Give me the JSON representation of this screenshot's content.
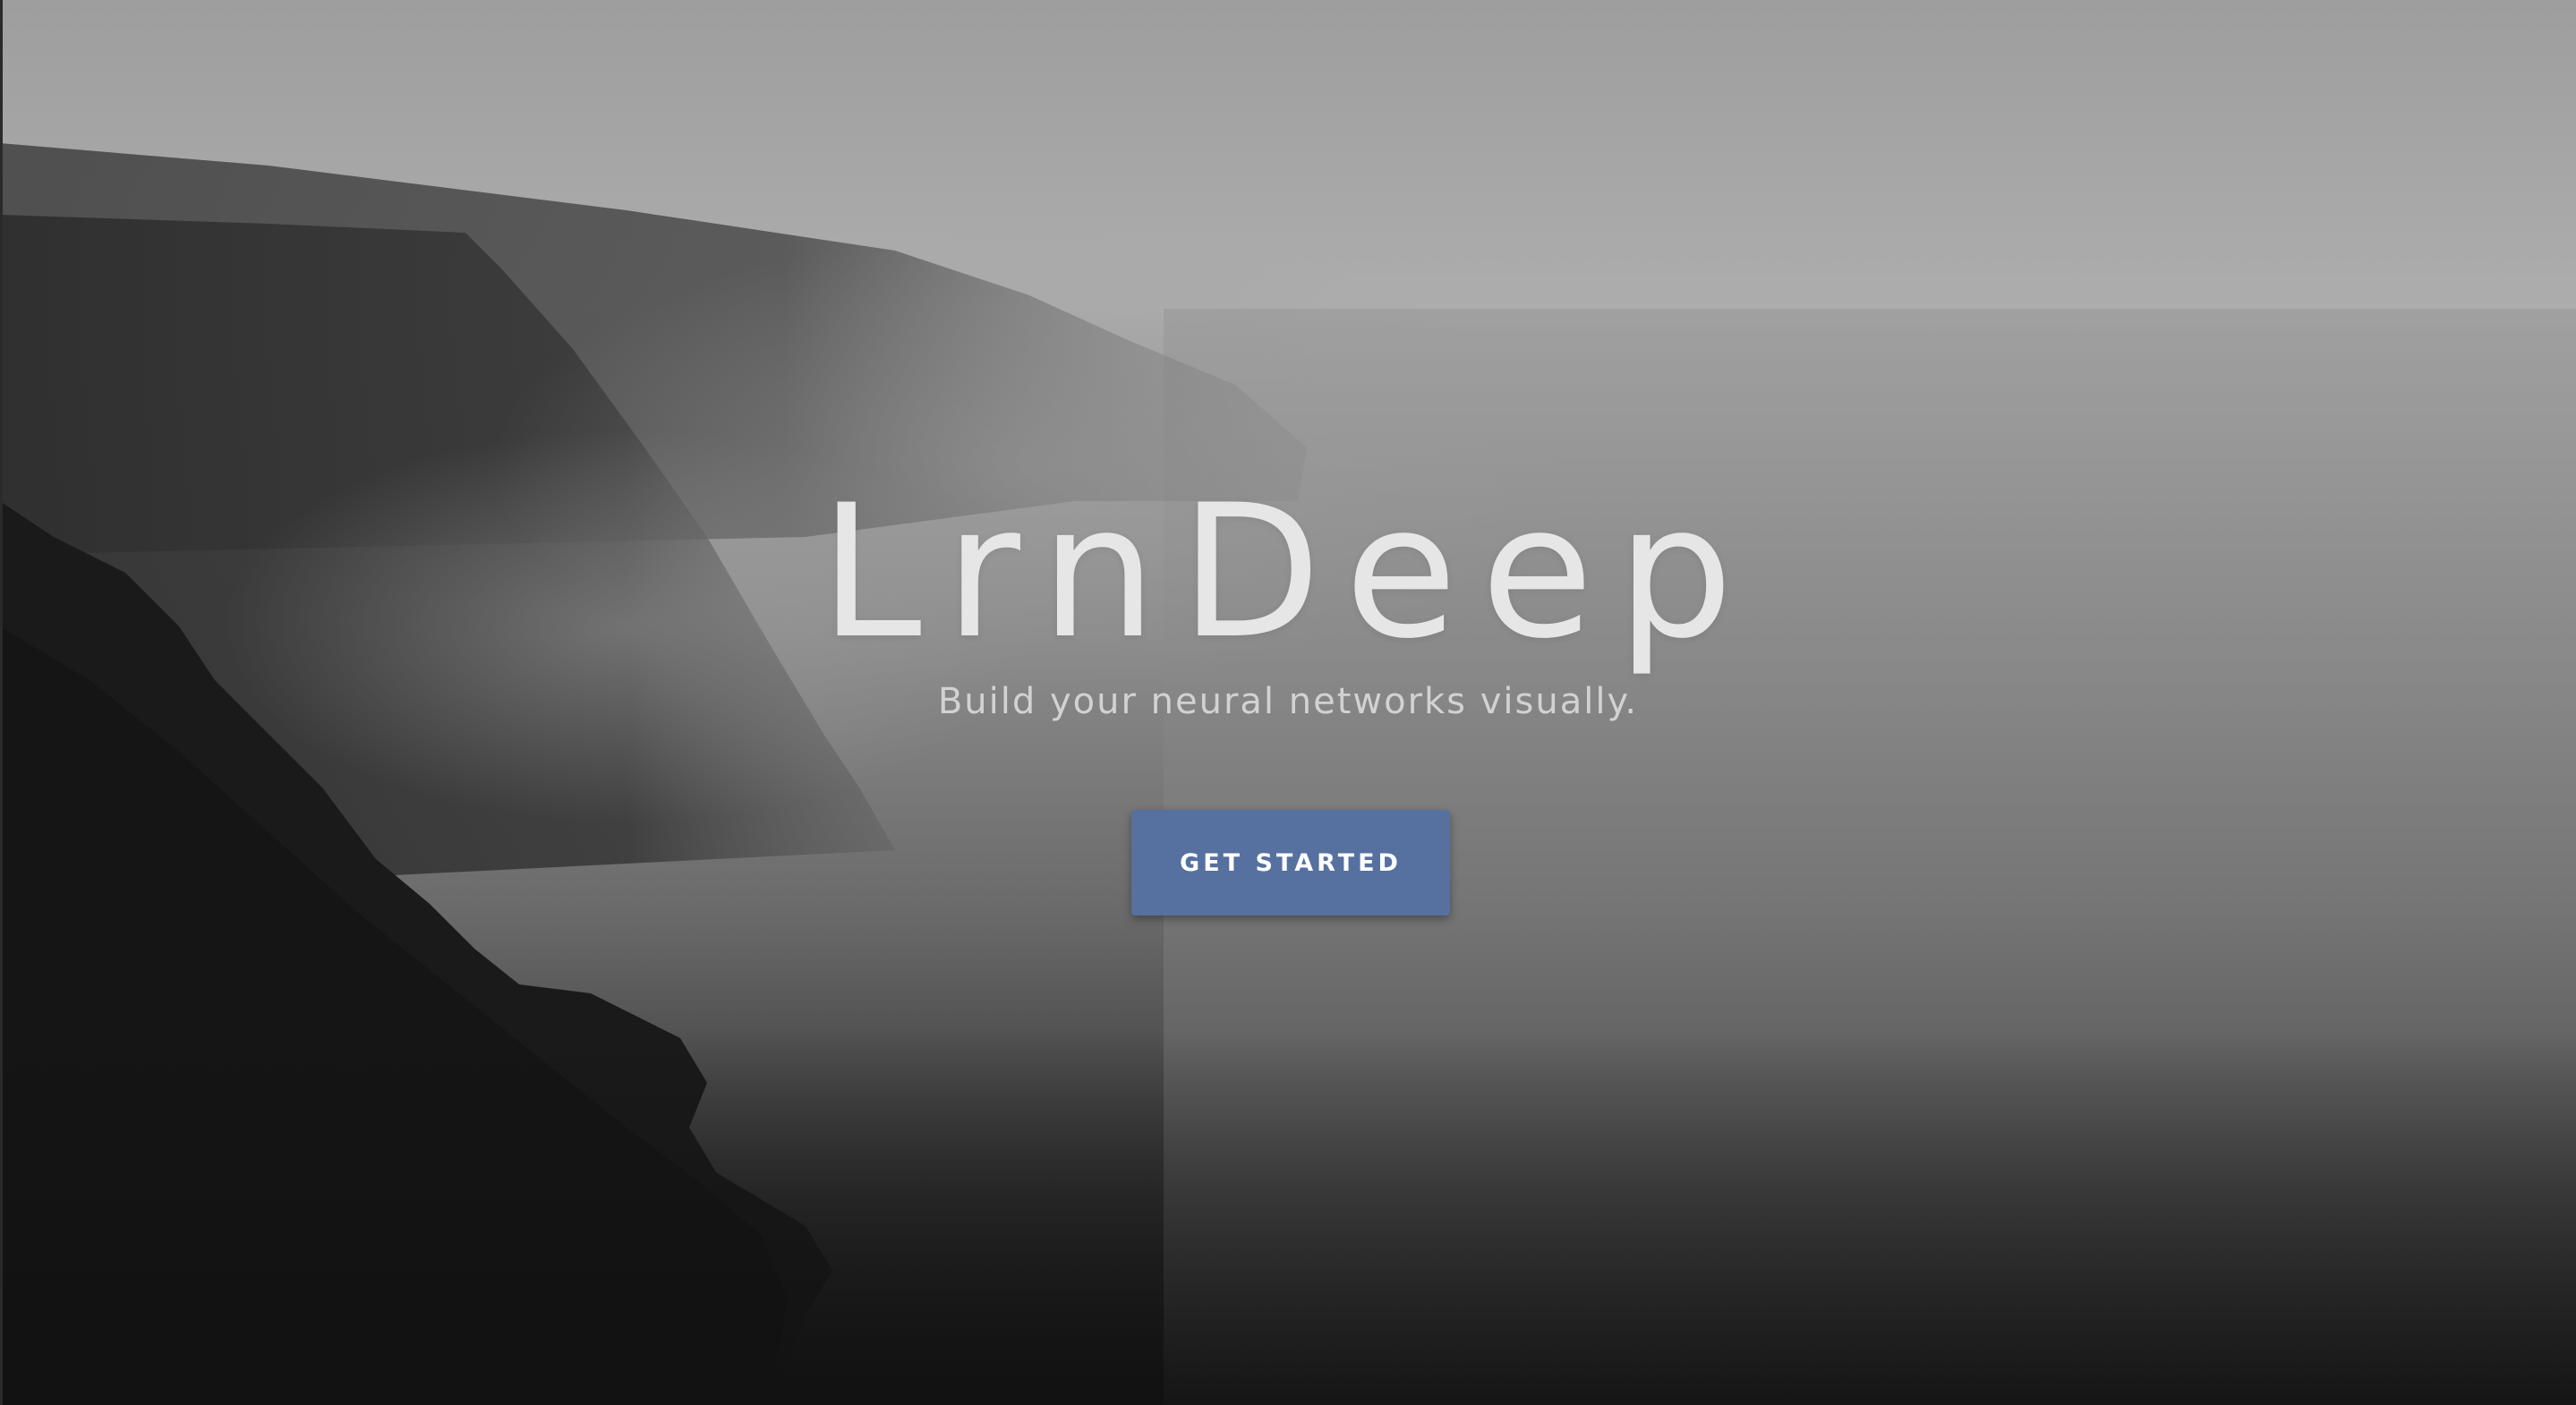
{
  "hero": {
    "title": "LrnDeep",
    "subtitle": "Build your neural networks visually.",
    "cta_label": "GET STARTED"
  },
  "colors": {
    "cta_background": "#56709f",
    "title_text": "#e6e6e6",
    "subtitle_text": "#d2d2d2"
  }
}
